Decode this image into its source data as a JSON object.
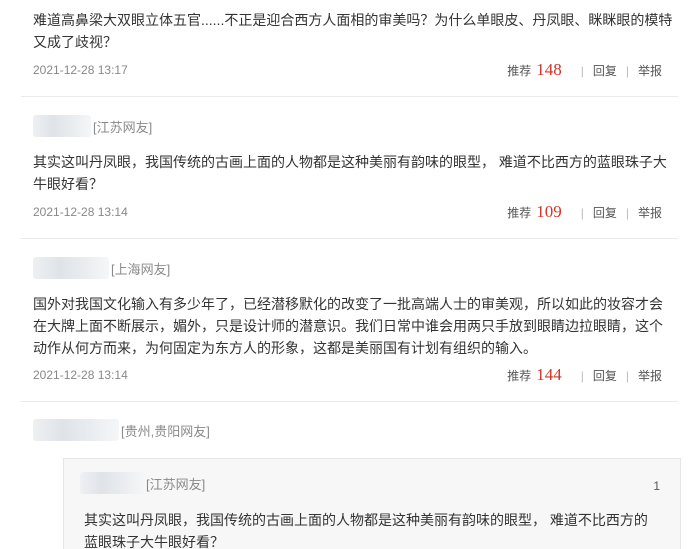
{
  "comments": [
    {
      "text": "难道高鼻梁大双眼立体五官......不正是迎合西方人面相的审美吗？为什么单眼皮、丹凤眼、眯眯眼的模特又成了歧视？",
      "time": "2021-12-28 13:17",
      "recommend_label": "推荐",
      "recommend_count": "148",
      "reply_label": "回复",
      "report_label": "举报"
    },
    {
      "region": "[江苏网友]",
      "text": "其实这叫丹凤眼，我国传统的古画上面的人物都是这种美丽有韵味的眼型，  难道不比西方的蓝眼珠子大牛眼好看？",
      "time": "2021-12-28 13:14",
      "recommend_label": "推荐",
      "recommend_count": "109",
      "reply_label": "回复",
      "report_label": "举报"
    },
    {
      "region": "[上海网友]",
      "text": "国外对我国文化输入有多少年了，已经潜移默化的改变了一批高端人士的审美观，所以如此的妆容才会在大牌上面不断展示，媚外，只是设计师的潜意识。我们日常中谁会用两只手放到眼睛边拉眼睛，这个动作从何方而来，为何固定为东方人的形象，这都是美丽国有计划有组织的输入。",
      "time": "2021-12-28 13:14",
      "recommend_label": "推荐",
      "recommend_count": "144",
      "reply_label": "回复",
      "report_label": "举报"
    },
    {
      "region": "[贵州,贵阳网友]",
      "quoted": {
        "region": "[江苏网友]",
        "floor": "1",
        "text": "其实这叫丹凤眼，我国传统的古画上面的人物都是这种美丽有韵味的眼型，  难道不比西方的蓝眼珠子大牛眼好看？"
      }
    }
  ]
}
